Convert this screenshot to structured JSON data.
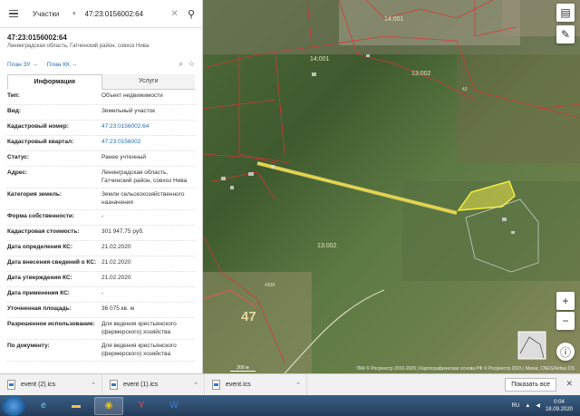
{
  "search": {
    "layer": "Участки",
    "query": "47:23:0156002:64",
    "clear_icon": "close-icon",
    "search_icon": "search-icon"
  },
  "object": {
    "title": "47:23:0156002:64",
    "subtitle": "Ленинградская область, Гатчинский район, совхоз Нива"
  },
  "links": {
    "plan_zu": "План ЗУ →",
    "plan_kk": "План КК →"
  },
  "tabs": {
    "info": "Информация",
    "services": "Услуги"
  },
  "info_rows": [
    {
      "key": "Тип:",
      "value": "Объект недвижимости"
    },
    {
      "key": "Вид:",
      "value": "Земельный участок"
    },
    {
      "key": "Кадастровый номер:",
      "value": "47:23:0156002:64"
    },
    {
      "key": "Кадастровый квартал:",
      "value": "47:23:0156002"
    },
    {
      "key": "Статус:",
      "value": "Ранее учтенный"
    },
    {
      "key": "Адрес:",
      "value": "Ленинградская область, Гатчинский район, совхоз Нива"
    },
    {
      "key": "Категория земель:",
      "value": "Земли сельскохозяйственного назначения"
    },
    {
      "key": "Форма собственности:",
      "value": "-"
    },
    {
      "key": "Кадастровая стоимость:",
      "value": "301 947,75 руб."
    },
    {
      "key": "Дата определения КС:",
      "value": "21.02.2020"
    },
    {
      "key": "Дата внесения сведений о КС:",
      "value": "21.02.2020"
    },
    {
      "key": "Дата утверждения КС:",
      "value": "21.02.2020"
    },
    {
      "key": "Дата применения КС:",
      "value": "-"
    },
    {
      "key": "Уточненная площадь:",
      "value": "36 075 кв. м"
    },
    {
      "key": "Разрешенное использование:",
      "value": "Для ведения крестьянского (фермерского) хозяйства"
    },
    {
      "key": "По документу:",
      "value": "Для ведения крестьянского (фермерского) хозяйства"
    }
  ],
  "map": {
    "labels": [
      "14:001",
      "13:002",
      "13:002",
      "47",
      "4308",
      "43",
      "64"
    ],
    "scale": "200 м",
    "attribution": "ПКК © Росреестр 2010-2020 | Картографическая основа РФ © Росреестр 2015 | Maxar, CNES/Airbus DS"
  },
  "downloads": {
    "files": [
      "event (2).ics",
      "event (1).ics",
      "event.ics"
    ],
    "show_all": "Показать все"
  },
  "taskbar": {
    "lang": "RU",
    "time": "0:04",
    "date": "18.09.2020"
  }
}
